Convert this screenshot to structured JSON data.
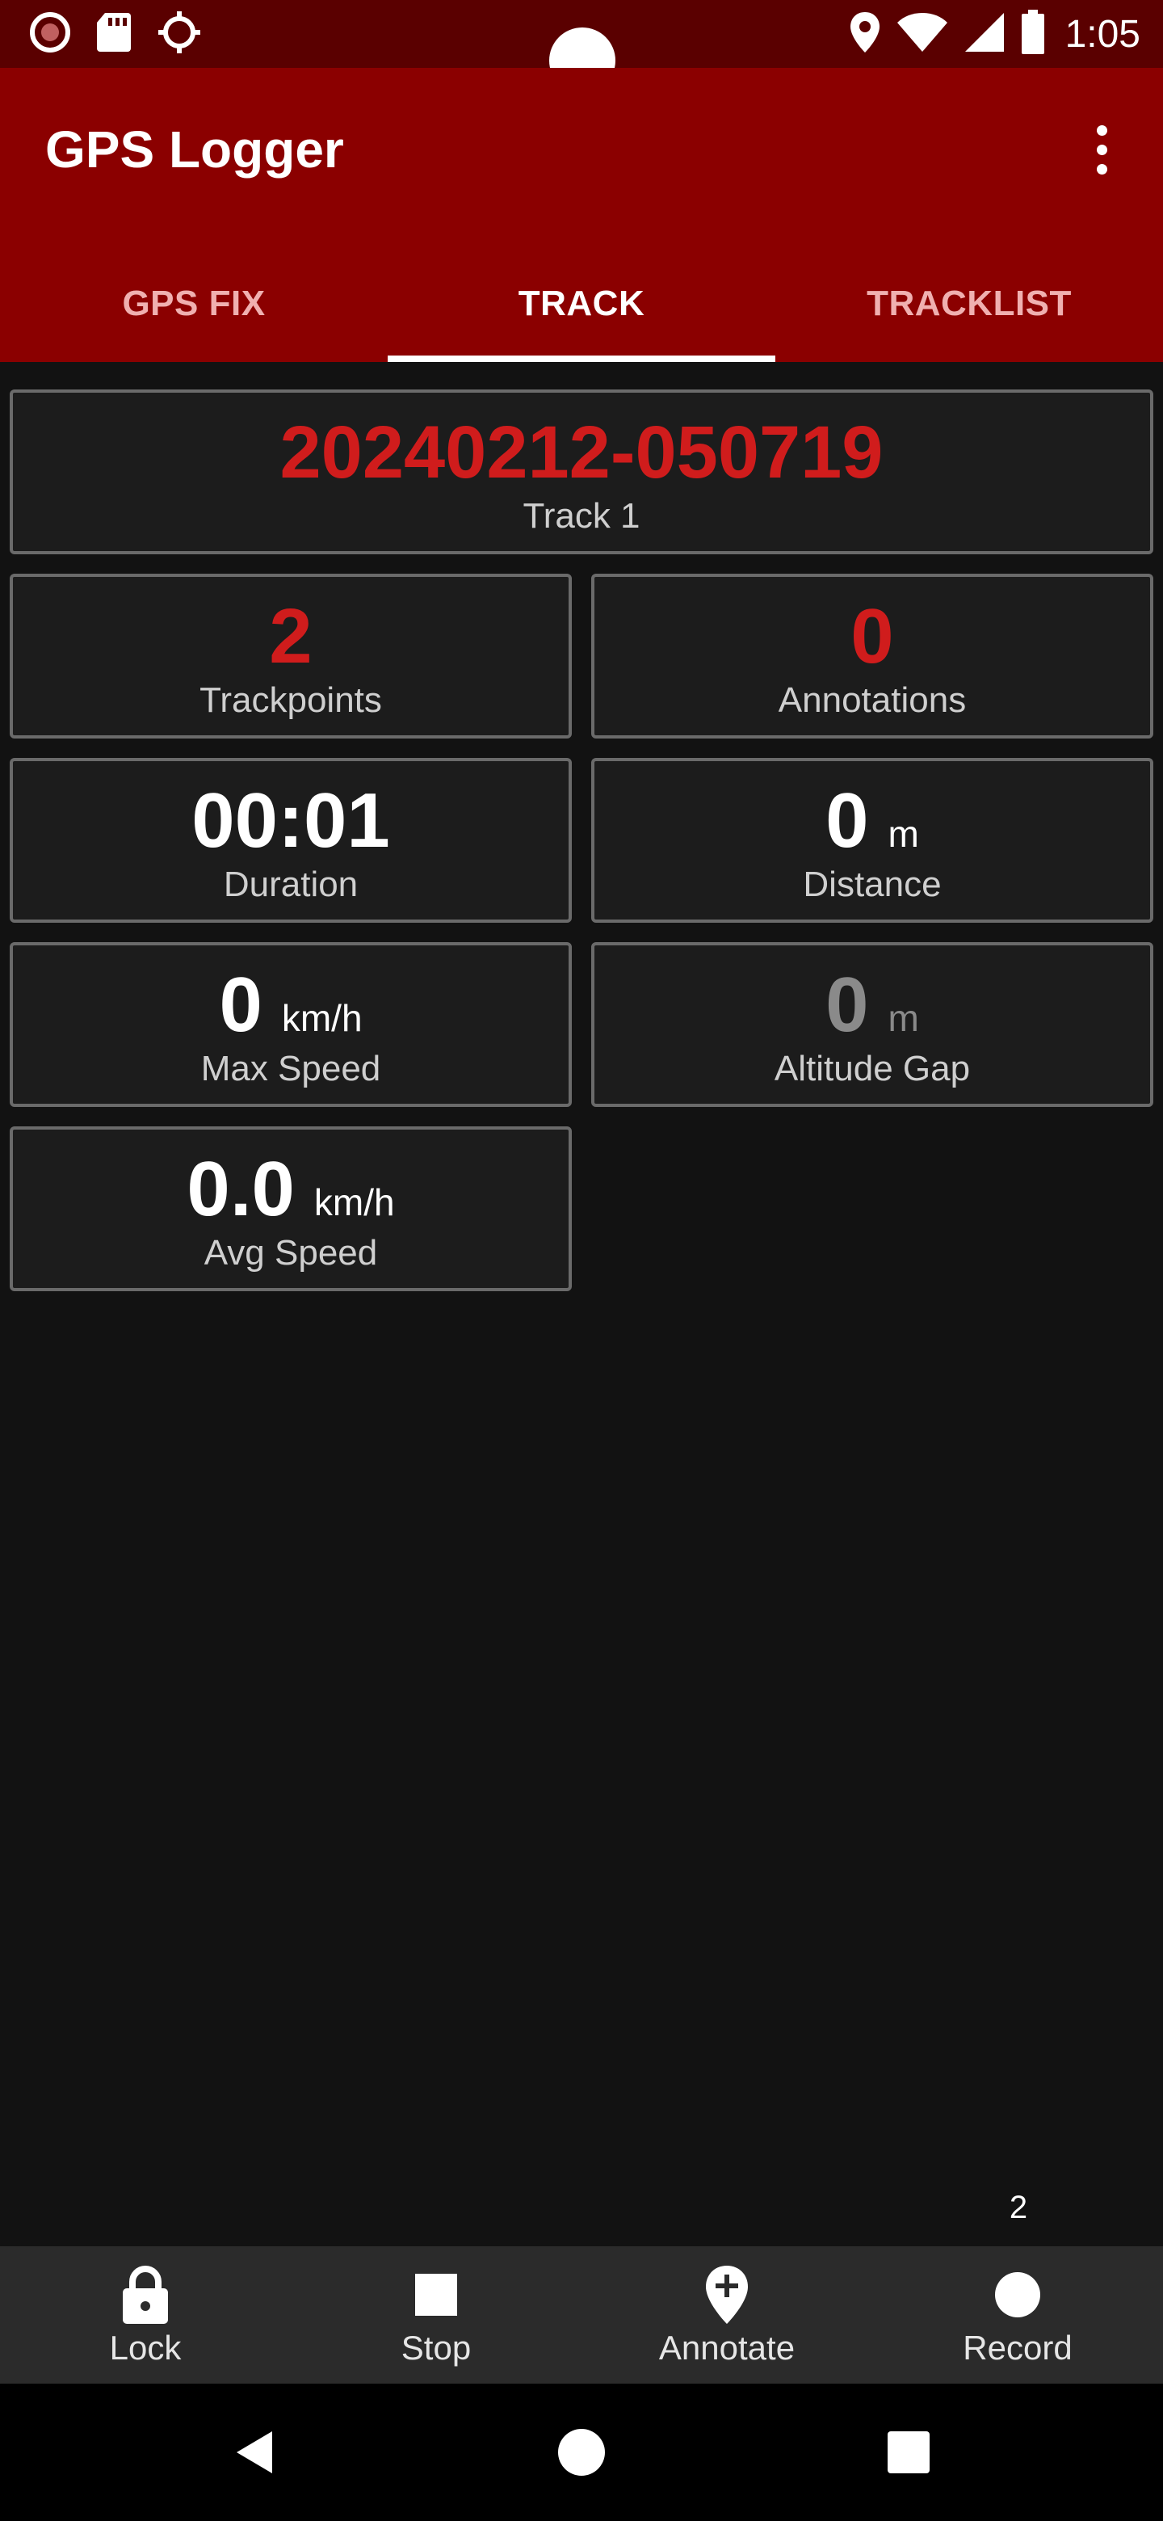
{
  "status_bar": {
    "time": "1:05",
    "left_icons": [
      "record-indicator-icon",
      "sd-card-icon",
      "gps-crosshair-icon"
    ],
    "right_icons": [
      "location-pin-icon",
      "wifi-icon",
      "cellular-signal-icon",
      "battery-icon"
    ]
  },
  "app": {
    "title": "GPS Logger",
    "menu_icon": "more-vert-icon"
  },
  "tabs": [
    {
      "label": "GPS FIX",
      "active": false
    },
    {
      "label": "TRACK",
      "active": true
    },
    {
      "label": "TRACKLIST",
      "active": false
    }
  ],
  "track": {
    "name": "20240212-050719",
    "name_label": "Track 1",
    "trackpoints": "2",
    "trackpoints_label": "Trackpoints",
    "annotations": "0",
    "annotations_label": "Annotations",
    "duration": "00:01",
    "duration_label": "Duration",
    "distance": "0",
    "distance_unit": "m",
    "distance_label": "Distance",
    "max_speed": "0",
    "max_speed_unit": "km/h",
    "max_speed_label": "Max Speed",
    "altitude_gap": "0",
    "altitude_gap_unit": "m",
    "altitude_gap_label": "Altitude Gap",
    "avg_speed": "0.0",
    "avg_speed_unit": "km/h",
    "avg_speed_label": "Avg Speed"
  },
  "counter": "2",
  "toolbar": {
    "lock_label": "Lock",
    "stop_label": "Stop",
    "annotate_label": "Annotate",
    "record_label": "Record"
  },
  "colors": {
    "status_bar": "#5a0000",
    "app_bar": "#8b0000",
    "accent_red": "#d01c1c",
    "background": "#121212",
    "card_border": "#6a6a6a"
  }
}
